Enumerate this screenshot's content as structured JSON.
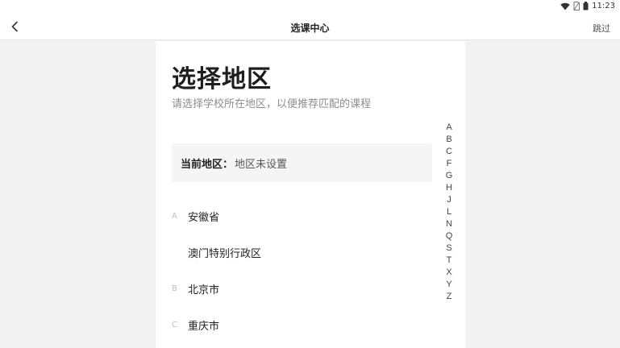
{
  "status_bar": {
    "time": "11:23",
    "icons": [
      "wifi-icon",
      "sim-icon",
      "battery-icon"
    ]
  },
  "header": {
    "title": "选课中心",
    "skip_label": "跳过",
    "back_icon": "chevron-left-icon"
  },
  "main": {
    "heading": "选择地区",
    "subheading": "请选择学校所在地区，以便推荐匹配的课程",
    "current_region": {
      "label": "当前地区：",
      "value": "地区未设置"
    },
    "regions": [
      {
        "letter": "A",
        "name": "安徽省"
      },
      {
        "letter": "",
        "name": "澳门特别行政区"
      },
      {
        "letter": "B",
        "name": "北京市"
      },
      {
        "letter": "C",
        "name": "重庆市"
      }
    ]
  },
  "index_letters": [
    "A",
    "B",
    "C",
    "F",
    "G",
    "H",
    "J",
    "L",
    "N",
    "Q",
    "S",
    "T",
    "X",
    "Y",
    "Z"
  ],
  "colors": {
    "background": "#f2f2f2",
    "panel": "#ffffff",
    "current_box": "#f5f5f5",
    "muted_text": "#8e8e8e",
    "index_letter_muted": "#bdbdbd"
  }
}
